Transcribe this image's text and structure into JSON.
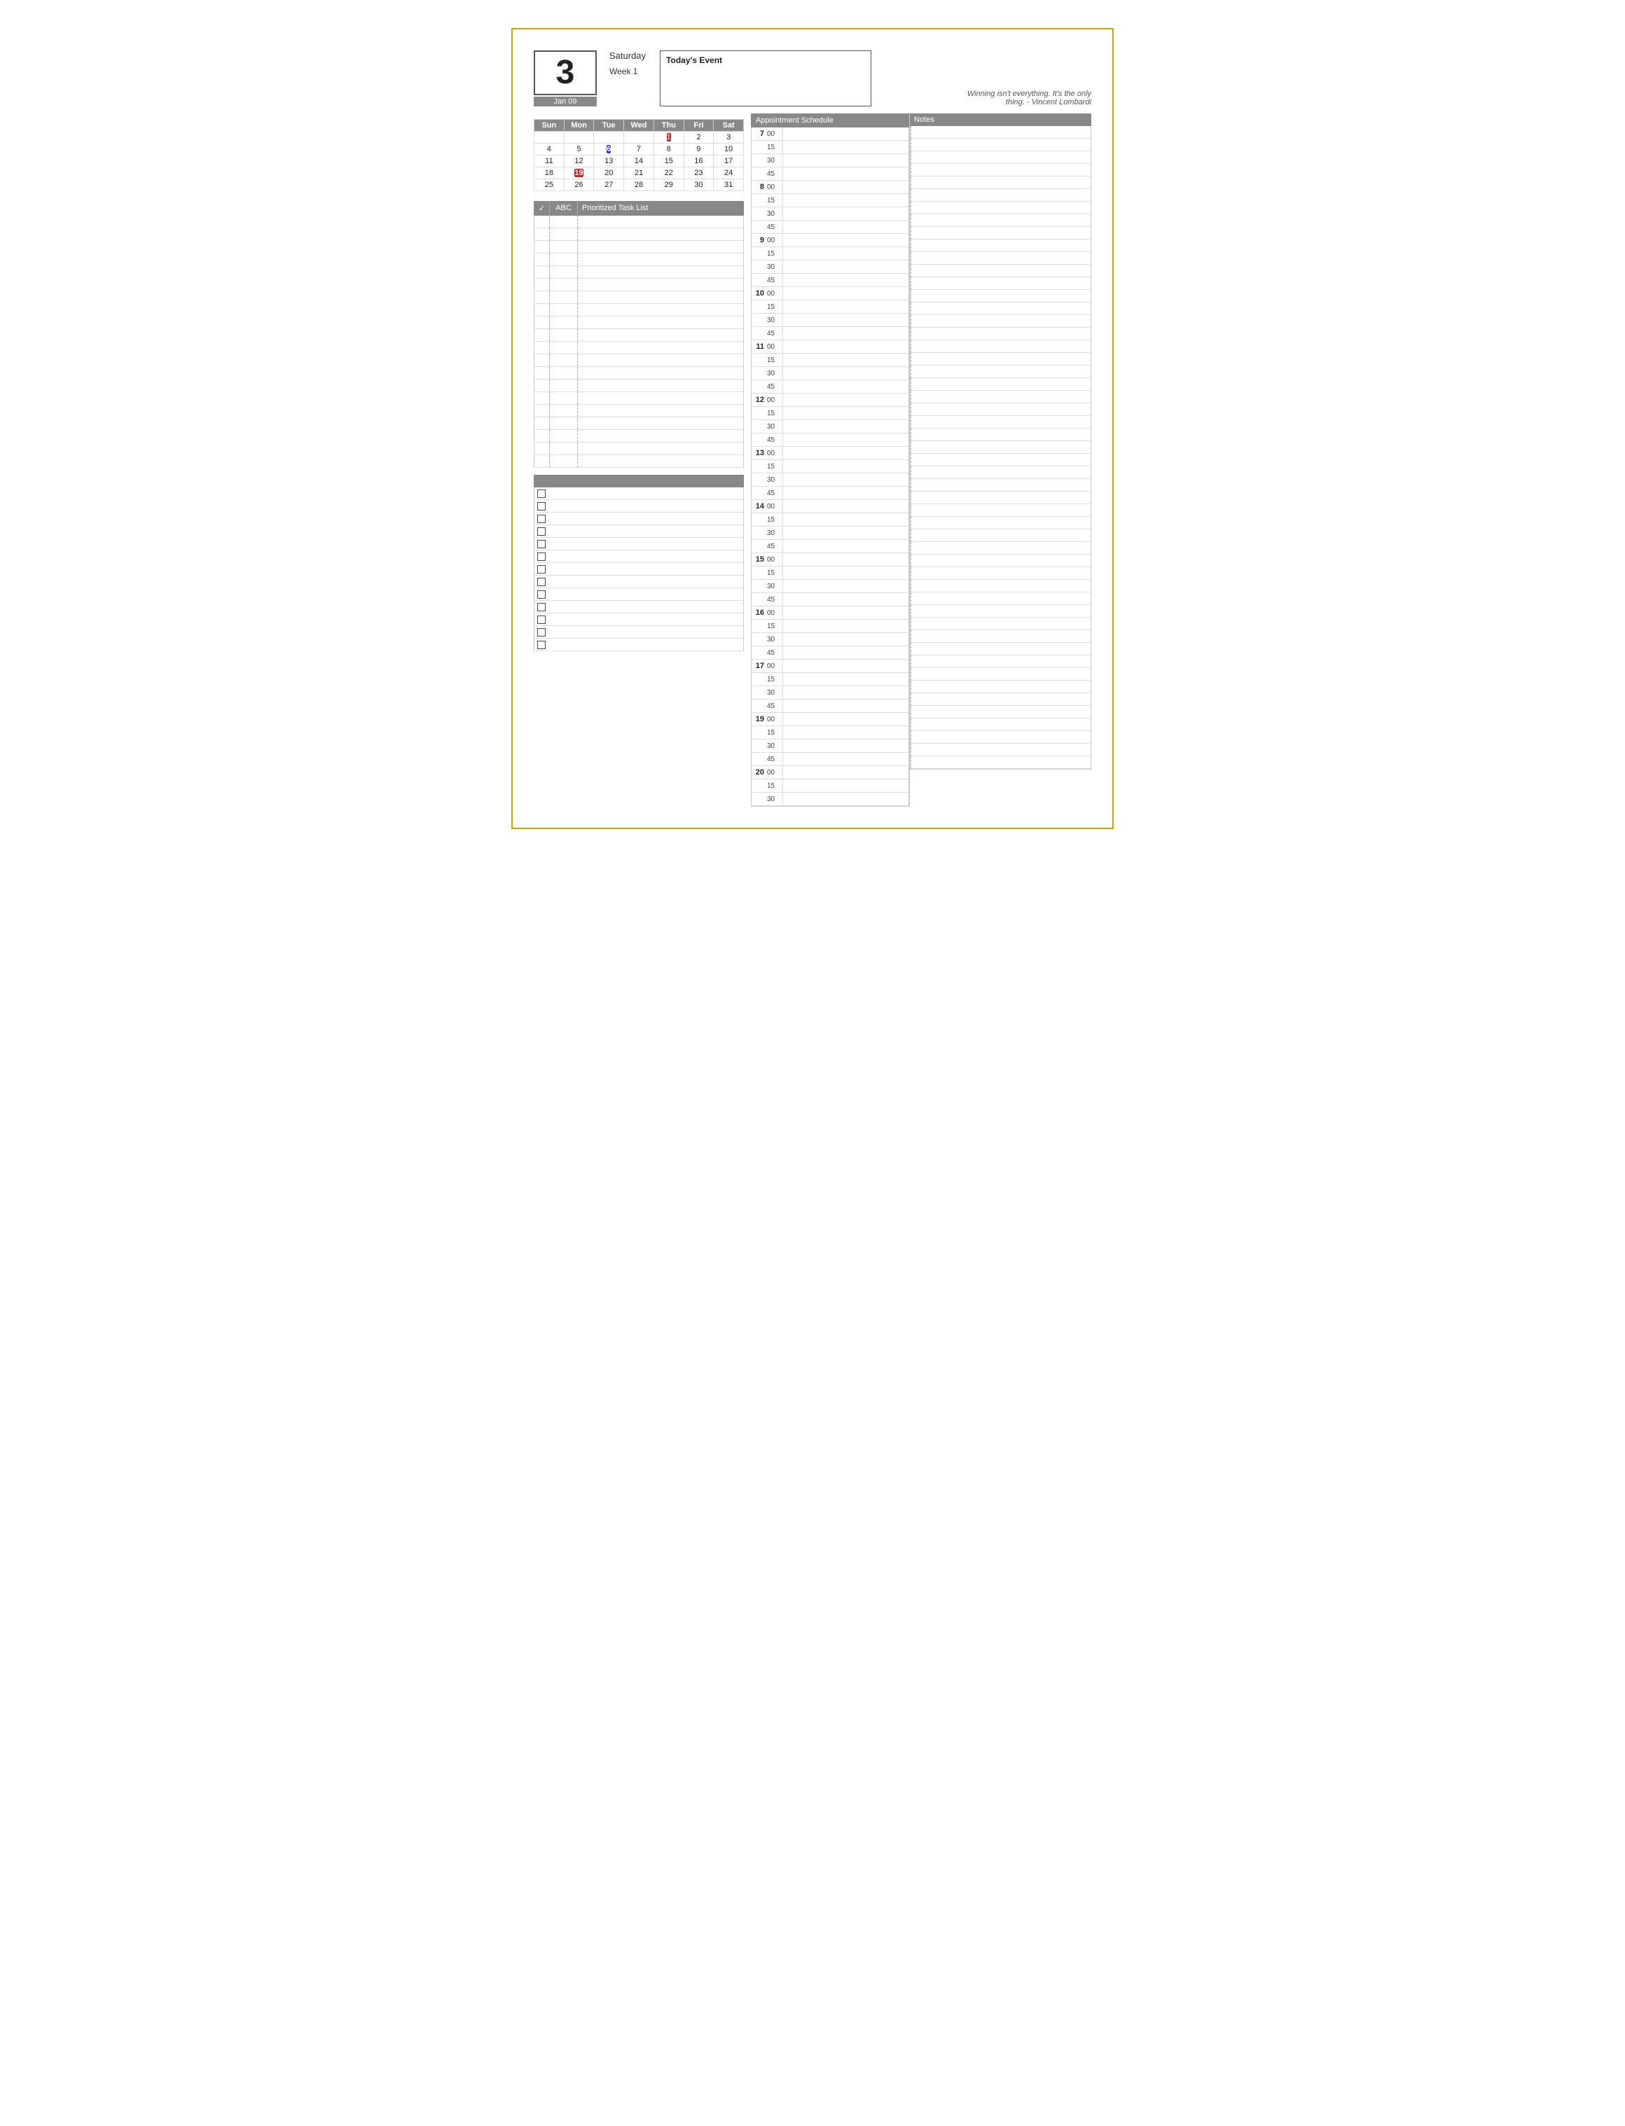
{
  "header": {
    "date_number": "3",
    "day_name": "Saturday",
    "week_label": "Week 1",
    "date_full": "Jan 09",
    "todays_event_label": "Today's Event",
    "quote": "Winning isn't everything. It's the only thing. - Vincent Lombardi"
  },
  "calendar": {
    "headers": [
      "Sun",
      "Mon",
      "Tue",
      "Wed",
      "Thu",
      "Fri",
      "Sat"
    ],
    "rows": [
      [
        "",
        "",
        "",
        "",
        "1",
        "2",
        "3"
      ],
      [
        "4",
        "5",
        "6",
        "7",
        "8",
        "9",
        "10"
      ],
      [
        "11",
        "12",
        "13",
        "14",
        "15",
        "16",
        "17"
      ],
      [
        "18",
        "19",
        "20",
        "21",
        "22",
        "23",
        "24"
      ],
      [
        "25",
        "26",
        "27",
        "28",
        "29",
        "30",
        "31"
      ]
    ]
  },
  "task_list": {
    "header_check": "✓",
    "header_abc": "ABC",
    "header_task": "Prioritized Task List",
    "rows": 20
  },
  "checkbox_section": {
    "rows": 13
  },
  "appointment_schedule": {
    "header": "Appointment Schedule",
    "notes_header": "Notes",
    "time_slots": [
      {
        "hour": "7",
        "minutes": [
          "00",
          "15",
          "30",
          "45"
        ]
      },
      {
        "hour": "8",
        "minutes": [
          "00",
          "15",
          "30",
          "45"
        ]
      },
      {
        "hour": "9",
        "minutes": [
          "00",
          "15",
          "30",
          "45"
        ]
      },
      {
        "hour": "10",
        "minutes": [
          "00",
          "15",
          "30",
          "45"
        ]
      },
      {
        "hour": "11",
        "minutes": [
          "00",
          "15",
          "30",
          "45"
        ]
      },
      {
        "hour": "12",
        "minutes": [
          "00",
          "15",
          "30",
          "45"
        ]
      },
      {
        "hour": "13",
        "minutes": [
          "00",
          "15",
          "30",
          "45"
        ]
      },
      {
        "hour": "14",
        "minutes": [
          "00",
          "15",
          "30",
          "45"
        ]
      },
      {
        "hour": "15",
        "minutes": [
          "00",
          "15",
          "30",
          "45"
        ]
      },
      {
        "hour": "16",
        "minutes": [
          "00",
          "15",
          "30",
          "45"
        ]
      },
      {
        "hour": "17",
        "minutes": [
          "00",
          "15",
          "30",
          "45"
        ]
      },
      {
        "hour": "19",
        "minutes": [
          "00",
          "15",
          "30",
          "45"
        ]
      },
      {
        "hour": "20",
        "minutes": [
          "00",
          "15",
          "30"
        ]
      }
    ]
  }
}
